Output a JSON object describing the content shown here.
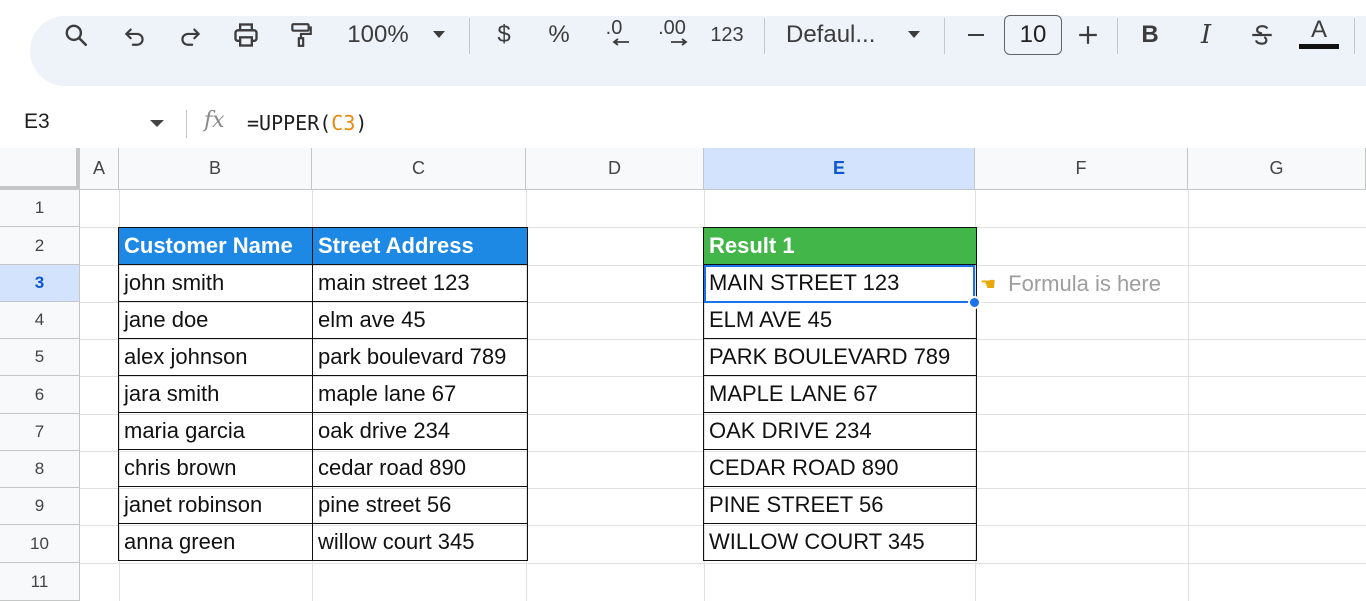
{
  "toolbar": {
    "zoom": "100%",
    "currency_label": "$",
    "percent_label": "%",
    "decrease_decimal_label": ".0",
    "increase_decimal_label": ".00",
    "format_number_label": "123",
    "font_name": "Defaul...",
    "font_size": "10",
    "bold_label": "B",
    "italic_label": "I",
    "text_color_label": "A"
  },
  "formula_bar": {
    "cell_ref": "E3",
    "fx_label": "fx",
    "formula_prefix": "=UPPER(",
    "formula_ref": "C3",
    "formula_suffix": ")"
  },
  "grid": {
    "columns": [
      "A",
      "B",
      "C",
      "D",
      "E",
      "F",
      "G"
    ],
    "rows": [
      "1",
      "2",
      "3",
      "4",
      "5",
      "6",
      "7",
      "8",
      "9",
      "10",
      "11"
    ],
    "active_col": "E",
    "active_row": "3"
  },
  "source_table": {
    "headers": [
      "Customer Name",
      "Street Address"
    ],
    "header_color": "#1e88e5",
    "rows": [
      [
        "john smith",
        "main street 123"
      ],
      [
        "jane doe",
        "elm ave 45"
      ],
      [
        "alex johnson",
        "park boulevard 789"
      ],
      [
        "jara smith",
        "maple lane 67"
      ],
      [
        "maria garcia",
        "oak drive 234"
      ],
      [
        "chris brown",
        "cedar road 890"
      ],
      [
        "janet robinson",
        "pine street 56"
      ],
      [
        "anna green",
        "willow court 345"
      ]
    ]
  },
  "result_table": {
    "header": "Result 1",
    "header_color": "#43b649",
    "rows": [
      "MAIN STREET 123",
      "ELM AVE 45",
      "PARK BOULEVARD 789",
      "MAPLE LANE 67",
      "OAK DRIVE 234",
      "CEDAR ROAD 890",
      "PINE STREET 56",
      "WILLOW COURT 345"
    ]
  },
  "annotation": {
    "icon": "pointing-hand-icon",
    "text": "Formula is here"
  },
  "colors": {
    "selection": "#1a73e8",
    "formula_ref": "#e8890c"
  }
}
